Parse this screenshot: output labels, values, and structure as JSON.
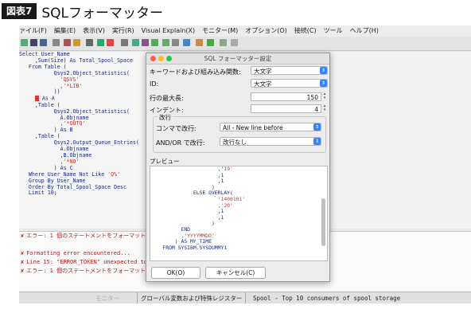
{
  "caption": {
    "badge": "図表7",
    "title": "SQLフォーマッター"
  },
  "menubar": [
    "ァイル(F)",
    "編集(E)",
    "表示(V)",
    "実行(R)",
    "Visual Explain(X)",
    "モニター(M)",
    "オプション(O)",
    "接続(C)",
    "ツール",
    "ヘルプ(H)"
  ],
  "editor_lines": [
    {
      "t": "Select User_Name"
    },
    {
      "t": "     ,Sum(Size) As Total_Spool_Space"
    },
    {
      "t": "   From Table ("
    },
    {
      "t": "           Qsys2.Object_Statistics("
    },
    {
      "t": "             'QSYS'",
      "s": true
    },
    {
      "t": "             ,'*LIB'",
      "s": true
    },
    {
      "t": "           ))"
    },
    {
      "t": ""
    },
    {
      "t": "     X As A",
      "mark": true
    },
    {
      "t": "     ,Table ("
    },
    {
      "t": "           Qsys2.Object_Statistics("
    },
    {
      "t": "             A.Objname"
    },
    {
      "t": "             ,'*OUTQ'",
      "s": true
    },
    {
      "t": "           ) As B"
    },
    {
      "t": "     ,Table ("
    },
    {
      "t": "           Qsys2.Output_Queue_Entries("
    },
    {
      "t": "             A.Objname"
    },
    {
      "t": "             ,B.Objname"
    },
    {
      "t": "             ,'*NO'",
      "s": true
    },
    {
      "t": "           ) As C"
    },
    {
      "t": "   Where User_Name Not Like 'Q%'",
      "hlq": true
    },
    {
      "t": "   Group By User_Name"
    },
    {
      "t": "   Order By Total_Spool_Space Desc"
    },
    {
      "t": "   Limit 10;"
    }
  ],
  "messages": [
    "エラー: 1 個のステートメントをフォーマットでき",
    "",
    "Formatting error encountered...",
    "Line 15: \"ERROR_TOKEN\" unexpected token",
    "エラー: 1 個のステートメントをフォーマットでき"
  ],
  "statusbar": {
    "faded": "モニター",
    "globals": "グローバル変数および特殊レジスター",
    "spool": "Spool - Top 10 consumers of spool storage"
  },
  "dialog": {
    "title": "SQL フォーマッター設定",
    "keyword_case_label": "キーワードおよび組み込み関数:",
    "keyword_case_value": "大文字",
    "id_label": "ID:",
    "id_value": "大文字",
    "max_line_label": "行の最大長:",
    "max_line_value": "150",
    "indent_label": "インデント:",
    "indent_value": "4",
    "newline_group": "改行",
    "comma_label": "コンマで改行:",
    "comma_value": "All - New line before",
    "andor_label": "AND/OR で改行:",
    "andor_value": "改行なし",
    "preview_label": "プレビュー",
    "preview_lines": [
      "                      ,'19'",
      "                      ,1",
      "                      ,1",
      "                    )",
      "              ELSE OVERLAY(",
      "                      '1400101'",
      "                      ,'20'",
      "                      ,1",
      "                      ,1",
      "                    )",
      "",
      "          END",
      "          ,'YYYYMMDD'",
      "        ) AS MY_TIME",
      "    FROM SYSIBM.SYSDUMMY1"
    ],
    "ok_label": "OK(O)",
    "cancel_label": "キャンセル(C)"
  }
}
